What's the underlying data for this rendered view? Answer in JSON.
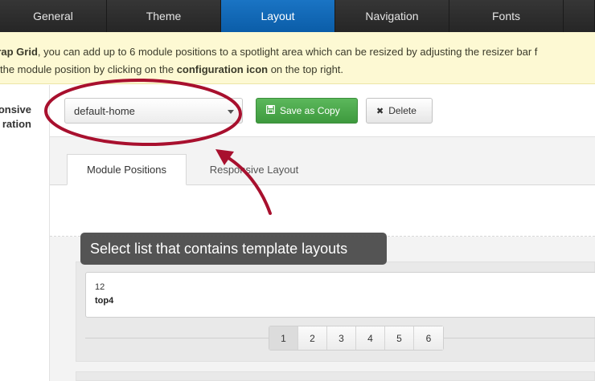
{
  "topnav": {
    "tabs": [
      {
        "label": "General"
      },
      {
        "label": "Theme"
      },
      {
        "label": "Layout",
        "active": true
      },
      {
        "label": "Navigation"
      },
      {
        "label": "Fonts"
      }
    ]
  },
  "notice": {
    "line1_a": "trap Grid",
    "line1_b": ", you can add up to 6 module positions to a spotlight area which can be resized by adjusting the resizer bar f",
    "line2_a": "the module position by clicking on the ",
    "line2_b": "configuration icon",
    "line2_c": " on the top right."
  },
  "leftcol": {
    "label_line1": "onsive",
    "label_line2": "ration"
  },
  "layout_select": {
    "value": "default-home"
  },
  "buttons": {
    "save_copy": "Save as Copy",
    "delete": "Delete"
  },
  "subtabs": [
    {
      "label": "Module Positions",
      "active": true
    },
    {
      "label": "Responsive Layout"
    }
  ],
  "tooltip": {
    "text": "Select list that contains template layouts"
  },
  "module": {
    "span": "12",
    "name": "top4"
  },
  "pager": {
    "pages": [
      "1",
      "2",
      "3",
      "4",
      "5",
      "6"
    ],
    "active": "1"
  },
  "colors": {
    "nav_active": "#0b5da8",
    "save_green": "#4cae4c",
    "annotation_red": "#a8102e",
    "notice_bg": "#fdf9d3"
  },
  "icons": {
    "save": "floppy-disk-icon",
    "delete": "x-icon"
  }
}
